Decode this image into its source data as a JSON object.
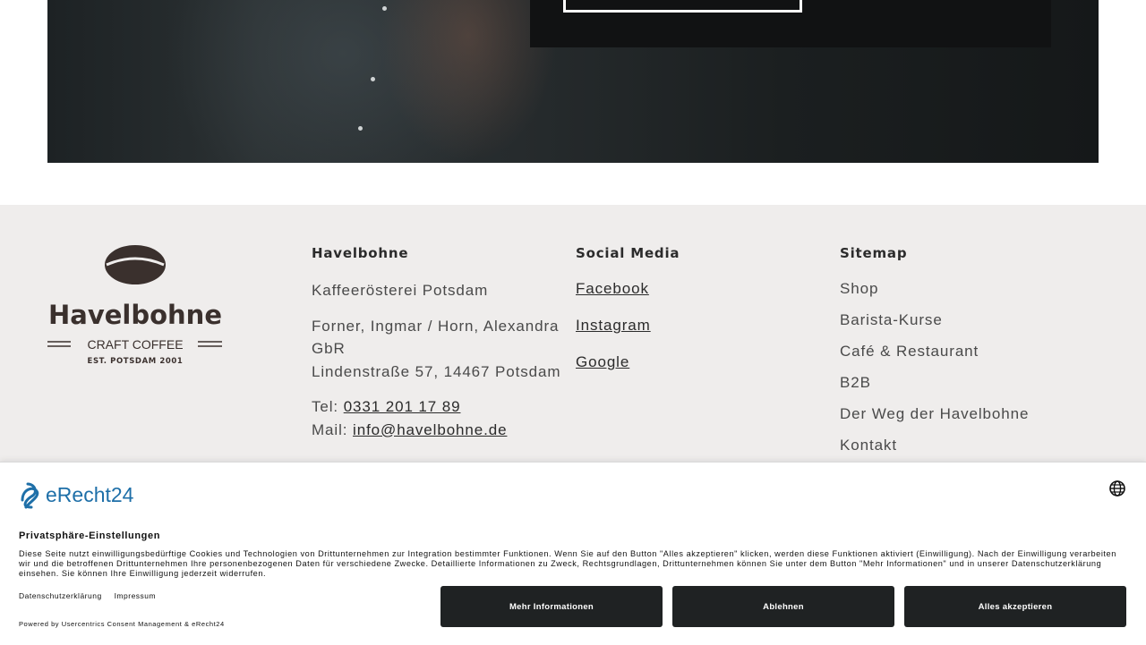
{
  "footer": {
    "logo": {
      "name": "Havelbohne",
      "tagline": "CRAFT COFFEE",
      "est": "EST. POTSDAM 2001"
    },
    "col1": {
      "title": "Havelbohne",
      "subtitle": "Kaffeerösterei Potsdam",
      "company": "Forner, Ingmar / Horn, Alexandra GbR",
      "address": "Lindenstraße 57, 14467 Potsdam",
      "tel_label": "Tel:",
      "tel": "0331 201 17 89",
      "mail_label": "Mail:",
      "mail": "info@havelbohne.de"
    },
    "col2": {
      "title": "Social Media",
      "links": [
        "Facebook",
        "Instagram",
        "Google"
      ]
    },
    "col3": {
      "title": "Sitemap",
      "links": [
        "Shop",
        "Barista-Kurse",
        "Café & Restaurant",
        "B2B",
        "Der Weg der Havelbohne",
        "Kontakt"
      ]
    }
  },
  "consent": {
    "brand": "eRecht24",
    "title": "Privatsphäre-Einstellungen",
    "description": "Diese Seite nutzt einwilligungsbedürftige Cookies und Technologien von Drittunternehmen zur Integration bestimmter Funktionen. Wenn Sie auf den Button \"Alles akzeptieren\" klicken, werden diese Funktionen aktiviert (Einwilligung). Nach der Einwilligung verarbeiten wir und die betroffenen Drittunternehmen Ihre personenbezogenen Daten für verschiedene Zwecke. Detaillierte Informationen zu Zweck, Rechtsgrundlagen, Drittunternehmen können Sie unter dem Button \"Mehr Informationen\" und in unserer Datenschutzerklärung einsehen. Sie können Ihre Einwilligung jederzeit widerrufen.",
    "link_privacy": "Datenschutzerklärung",
    "link_imprint": "Impressum",
    "powered": "Powered by Usercentrics Consent Management & eRecht24",
    "btn_more": "Mehr Informationen",
    "btn_decline": "Ablehnen",
    "btn_accept": "Alles akzeptieren"
  },
  "colors": {
    "footer_bg": "#efedec",
    "button_bg": "#1f2223",
    "brand_blue": "#1e6fa8"
  }
}
